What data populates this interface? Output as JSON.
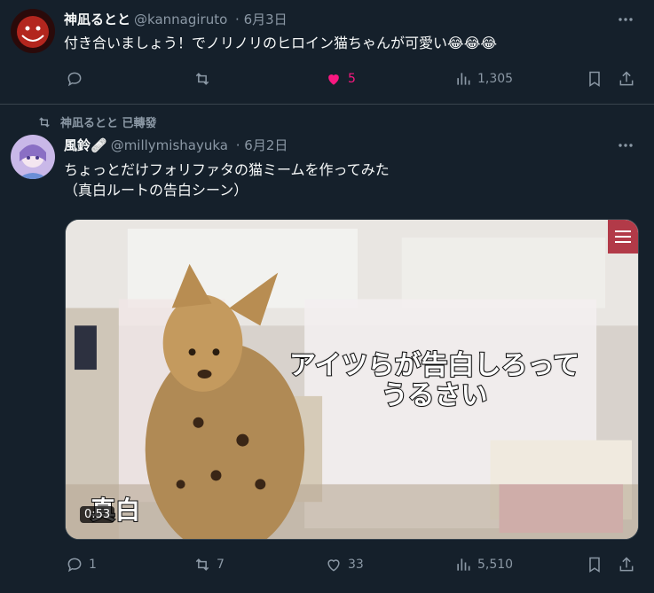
{
  "tweet1": {
    "display_name": "神凪るとと",
    "handle": "@kannagiruto",
    "date": "6月3日",
    "text": "付き合いましょう！でノリノリのヒロイン猫ちゃんが可愛い😂😂😂",
    "actions": {
      "replies": "",
      "retweets": "",
      "likes": "5",
      "views": "1,305"
    },
    "like_color": "#f91880"
  },
  "retweet_banner": "神凪るとと 已轉發",
  "tweet2": {
    "display_name": "風鈴🩹",
    "handle": "@millymishayuka",
    "date": "6月2日",
    "text_line1": "ちょっとだけフォリファタの猫ミームを作ってみた",
    "text_line2": "（真白ルートの告白シーン）",
    "media": {
      "caption_line1": "アイツらが告白しろって",
      "caption_line2": "うるさい",
      "name_tag": "真白",
      "duration": "0:53"
    },
    "actions": {
      "replies": "1",
      "retweets": "7",
      "likes": "33",
      "views": "5,510"
    }
  },
  "colors": {
    "background": "#15202b",
    "secondary_text": "#8b98a5",
    "divider": "#38444d"
  }
}
